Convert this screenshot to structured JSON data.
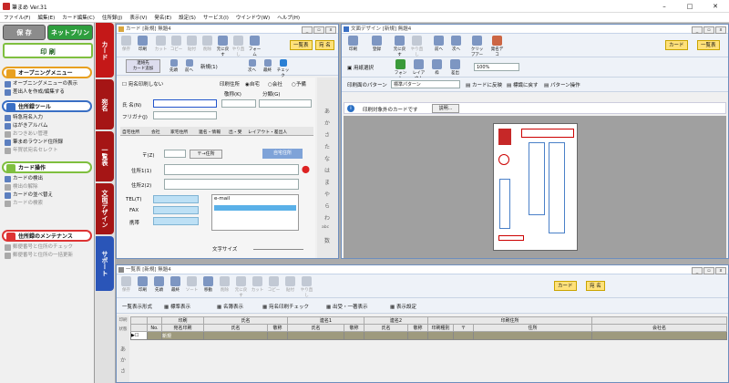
{
  "app": {
    "title": "筆まめ Ver.31"
  },
  "menu": [
    "ファイル(F)",
    "編集(E)",
    "カード編集(C)",
    "住所録(J)",
    "表示(V)",
    "発名(E)",
    "設定(S)",
    "サービス(I)",
    "ウインドウ(W)",
    "ヘルプ(H)"
  ],
  "left": {
    "save": "保 存",
    "netprint": "ネットプリント",
    "print": "印 刷",
    "sections": [
      {
        "title": "オープニングメニュー",
        "items": [
          "オープニングメニューの表示",
          "差出人を作成/編集する"
        ]
      },
      {
        "title": "住所録ツール",
        "items": [
          "特急宛名入力",
          "はがきアルバム",
          "おつきあい管理",
          "筆まめラウンド住所録",
          "年賀状宛名セレクト"
        ]
      },
      {
        "title": "カード操作",
        "items": [
          "カードの検出",
          "検出の解除",
          "カードの並べ替え",
          "カードの検索"
        ]
      },
      {
        "title": "住所録のメンテナンス",
        "items": [
          "郵便番号と住所のチェック",
          "郵便番号と住所の一括更新"
        ]
      }
    ]
  },
  "sidetabs": [
    "カード",
    "宛名",
    "一覧表",
    "文面デザイン",
    "サポート"
  ],
  "card": {
    "title": "カード [新規] 無題4",
    "toolbar": [
      "保存",
      "印刷",
      "カット",
      "コピー",
      "貼付",
      "削除",
      "元に戻す",
      "やり直し",
      "フォーム"
    ],
    "btn_list": "一覧表",
    "btn_atena": "宛 名",
    "renraku": "連絡先\nカード追加",
    "nav": [
      "先頭",
      "前へ",
      "新規(1)",
      "次へ",
      "最終"
    ],
    "check": "チェック",
    "print_off": "宛名印刷しない",
    "print_pos": "印刷住所",
    "print_opts": [
      "自宅",
      "会社",
      "予備"
    ],
    "label_name": "氏 名(N)",
    "label_kana": "フリガナ(J)",
    "label_keisho": "敬称(K)",
    "label_bunrui": "分類(G)",
    "tabs": [
      "自宅住所",
      "会社",
      "家宅住所",
      "連名・情報",
      "出・受",
      "レイアウト・差出人"
    ],
    "label_zip": "〒(Z)",
    "btn_zip": "〒→住所",
    "btn_free": "自宅住所",
    "label_addr1": "住所1(1)",
    "label_addr2": "住所2(2)",
    "label_tel": "TEL(T)",
    "label_fax": "FAX",
    "label_mobile": "携帯",
    "email_label": "e-mail",
    "font_size_label": "文字サイズ",
    "vchars": [
      "あ",
      "か",
      "さ",
      "た",
      "な",
      "は",
      "ま",
      "や",
      "ら",
      "わ",
      "abc",
      "数"
    ]
  },
  "design": {
    "title": "文面デザイン [新規] 無題4",
    "toolbar": [
      "印刷",
      "登録",
      "元に戻す",
      "やり直し",
      "前へ",
      "次へ",
      "クリップアート",
      "発名デコ"
    ],
    "btn_card": "カード",
    "btn_list": "一覧表",
    "row2": [
      "用紙選択",
      "フォント",
      "レイアウト",
      "枠",
      "差出"
    ],
    "zoom": "100%",
    "pattern_label": "印刷面のパターン",
    "pattern_value": "標準パターン",
    "card_apply": "カードに反映",
    "plain": "標識に戻す",
    "pattern_op": "パターン操作",
    "info": "印刷対象外のカードです",
    "explain": "説明..."
  },
  "list": {
    "title": "一覧表 [新規] 無題4",
    "toolbar": [
      "保存",
      "印刷",
      "先頭",
      "最終",
      "ソート",
      "移動",
      "削除",
      "元に戻す",
      "カット",
      "コピー",
      "貼付",
      "やり直し"
    ],
    "btn_card": "カード",
    "btn_atena": "宛 名",
    "row2": [
      "一覧表示形式",
      "標準表示",
      "名簿表示",
      "宛名印刷チェック",
      "出受・一著表示",
      "表示設定"
    ],
    "headers_top": [
      "印刷",
      "",
      "氏名",
      "",
      "連名1",
      "",
      "連名2",
      "",
      "",
      "印刷住所",
      ""
    ],
    "headers": [
      "No.",
      "宛名印刷",
      "氏名",
      "敬称",
      "氏名",
      "敬称",
      "氏名",
      "敬称",
      "印刷種別",
      "〒",
      "住所",
      "会社名"
    ],
    "left_chars": [
      "印刷",
      "状態",
      "あ",
      "か",
      "さ"
    ],
    "row_value": "新規"
  }
}
